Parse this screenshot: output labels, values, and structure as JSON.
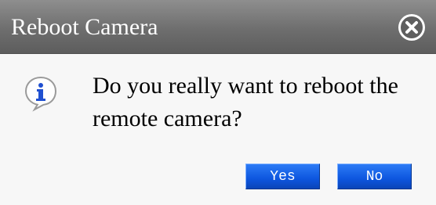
{
  "dialog": {
    "title": "Reboot Camera",
    "message": "Do you really want to reboot the remote camera?",
    "close_icon": "close-icon",
    "info_icon": "info-icon",
    "buttons": {
      "yes": "Yes",
      "no": "No"
    }
  },
  "colors": {
    "titlebar": "#6e6e6e",
    "button": "#0d56df",
    "icon_blue": "#1f4fd0"
  }
}
